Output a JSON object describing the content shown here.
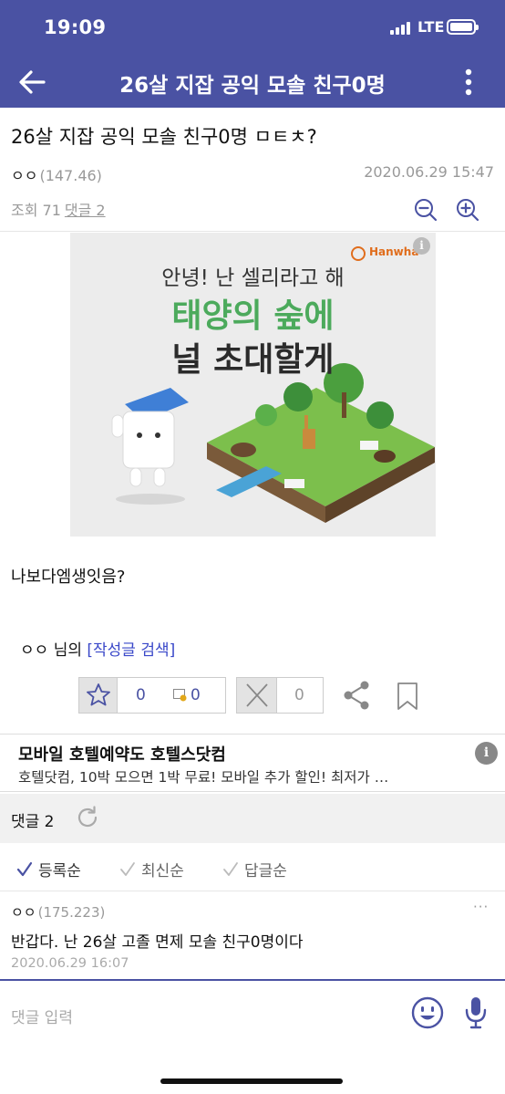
{
  "status_bar": {
    "time": "19:09",
    "network": "LTE"
  },
  "app_bar": {
    "title": "26살 지잡 공익 모솔 친구0명"
  },
  "post": {
    "title": "26살 지잡 공익 모솔 친구0명 ㅁㅌㅊ?",
    "author": "ㅇㅇ",
    "author_ip": "(147.46)",
    "date": "2020.06.29 15:47",
    "views_label": "조회 71",
    "comments_link": "댓글 2",
    "body": "나보다엠생잇음?",
    "author_suffix": "님의",
    "author_search_link": "[작성글 검색]"
  },
  "banner_ad": {
    "brand": "Hanwha",
    "info": "i",
    "line1": "안녕! 난 셀리라고 해",
    "line2": "태양의 숲에",
    "line3": "널 초대할게"
  },
  "actions": {
    "recommend_count": "0",
    "fixed_recommend_count": "0",
    "dislike_count": "0"
  },
  "text_ad": {
    "headline": "모바일 호텔예약도 호텔스닷컴",
    "description": "호텔닷컴, 10박 모으면 1박 무료! 모바일 추가 할인! 최저가 …",
    "info": "i"
  },
  "comments": {
    "header": "댓글 2",
    "sort_options": [
      "등록순",
      "최신순",
      "답글순"
    ],
    "selected_sort": "등록순",
    "items": [
      {
        "author": "ㅇㅇ",
        "ip": "(175.223)",
        "text": "반갑다. 난 26살 고졸 면제 모솔 친구0명이다",
        "date": "2020.06.29 16:07",
        "more": "···"
      }
    ]
  },
  "comment_input": {
    "placeholder": "댓글 입력"
  },
  "colors": {
    "brand": "#4a52a3",
    "link": "#3a48c9",
    "banner_green": "#4caa5c"
  },
  "icons": [
    "back-arrow-icon",
    "more-vert-icon",
    "zoom-out-icon",
    "zoom-in-icon",
    "star-icon",
    "image-badge-icon",
    "x-icon",
    "share-icon",
    "bookmark-icon",
    "refresh-icon",
    "check-icon",
    "emoji-icon",
    "mic-icon"
  ]
}
